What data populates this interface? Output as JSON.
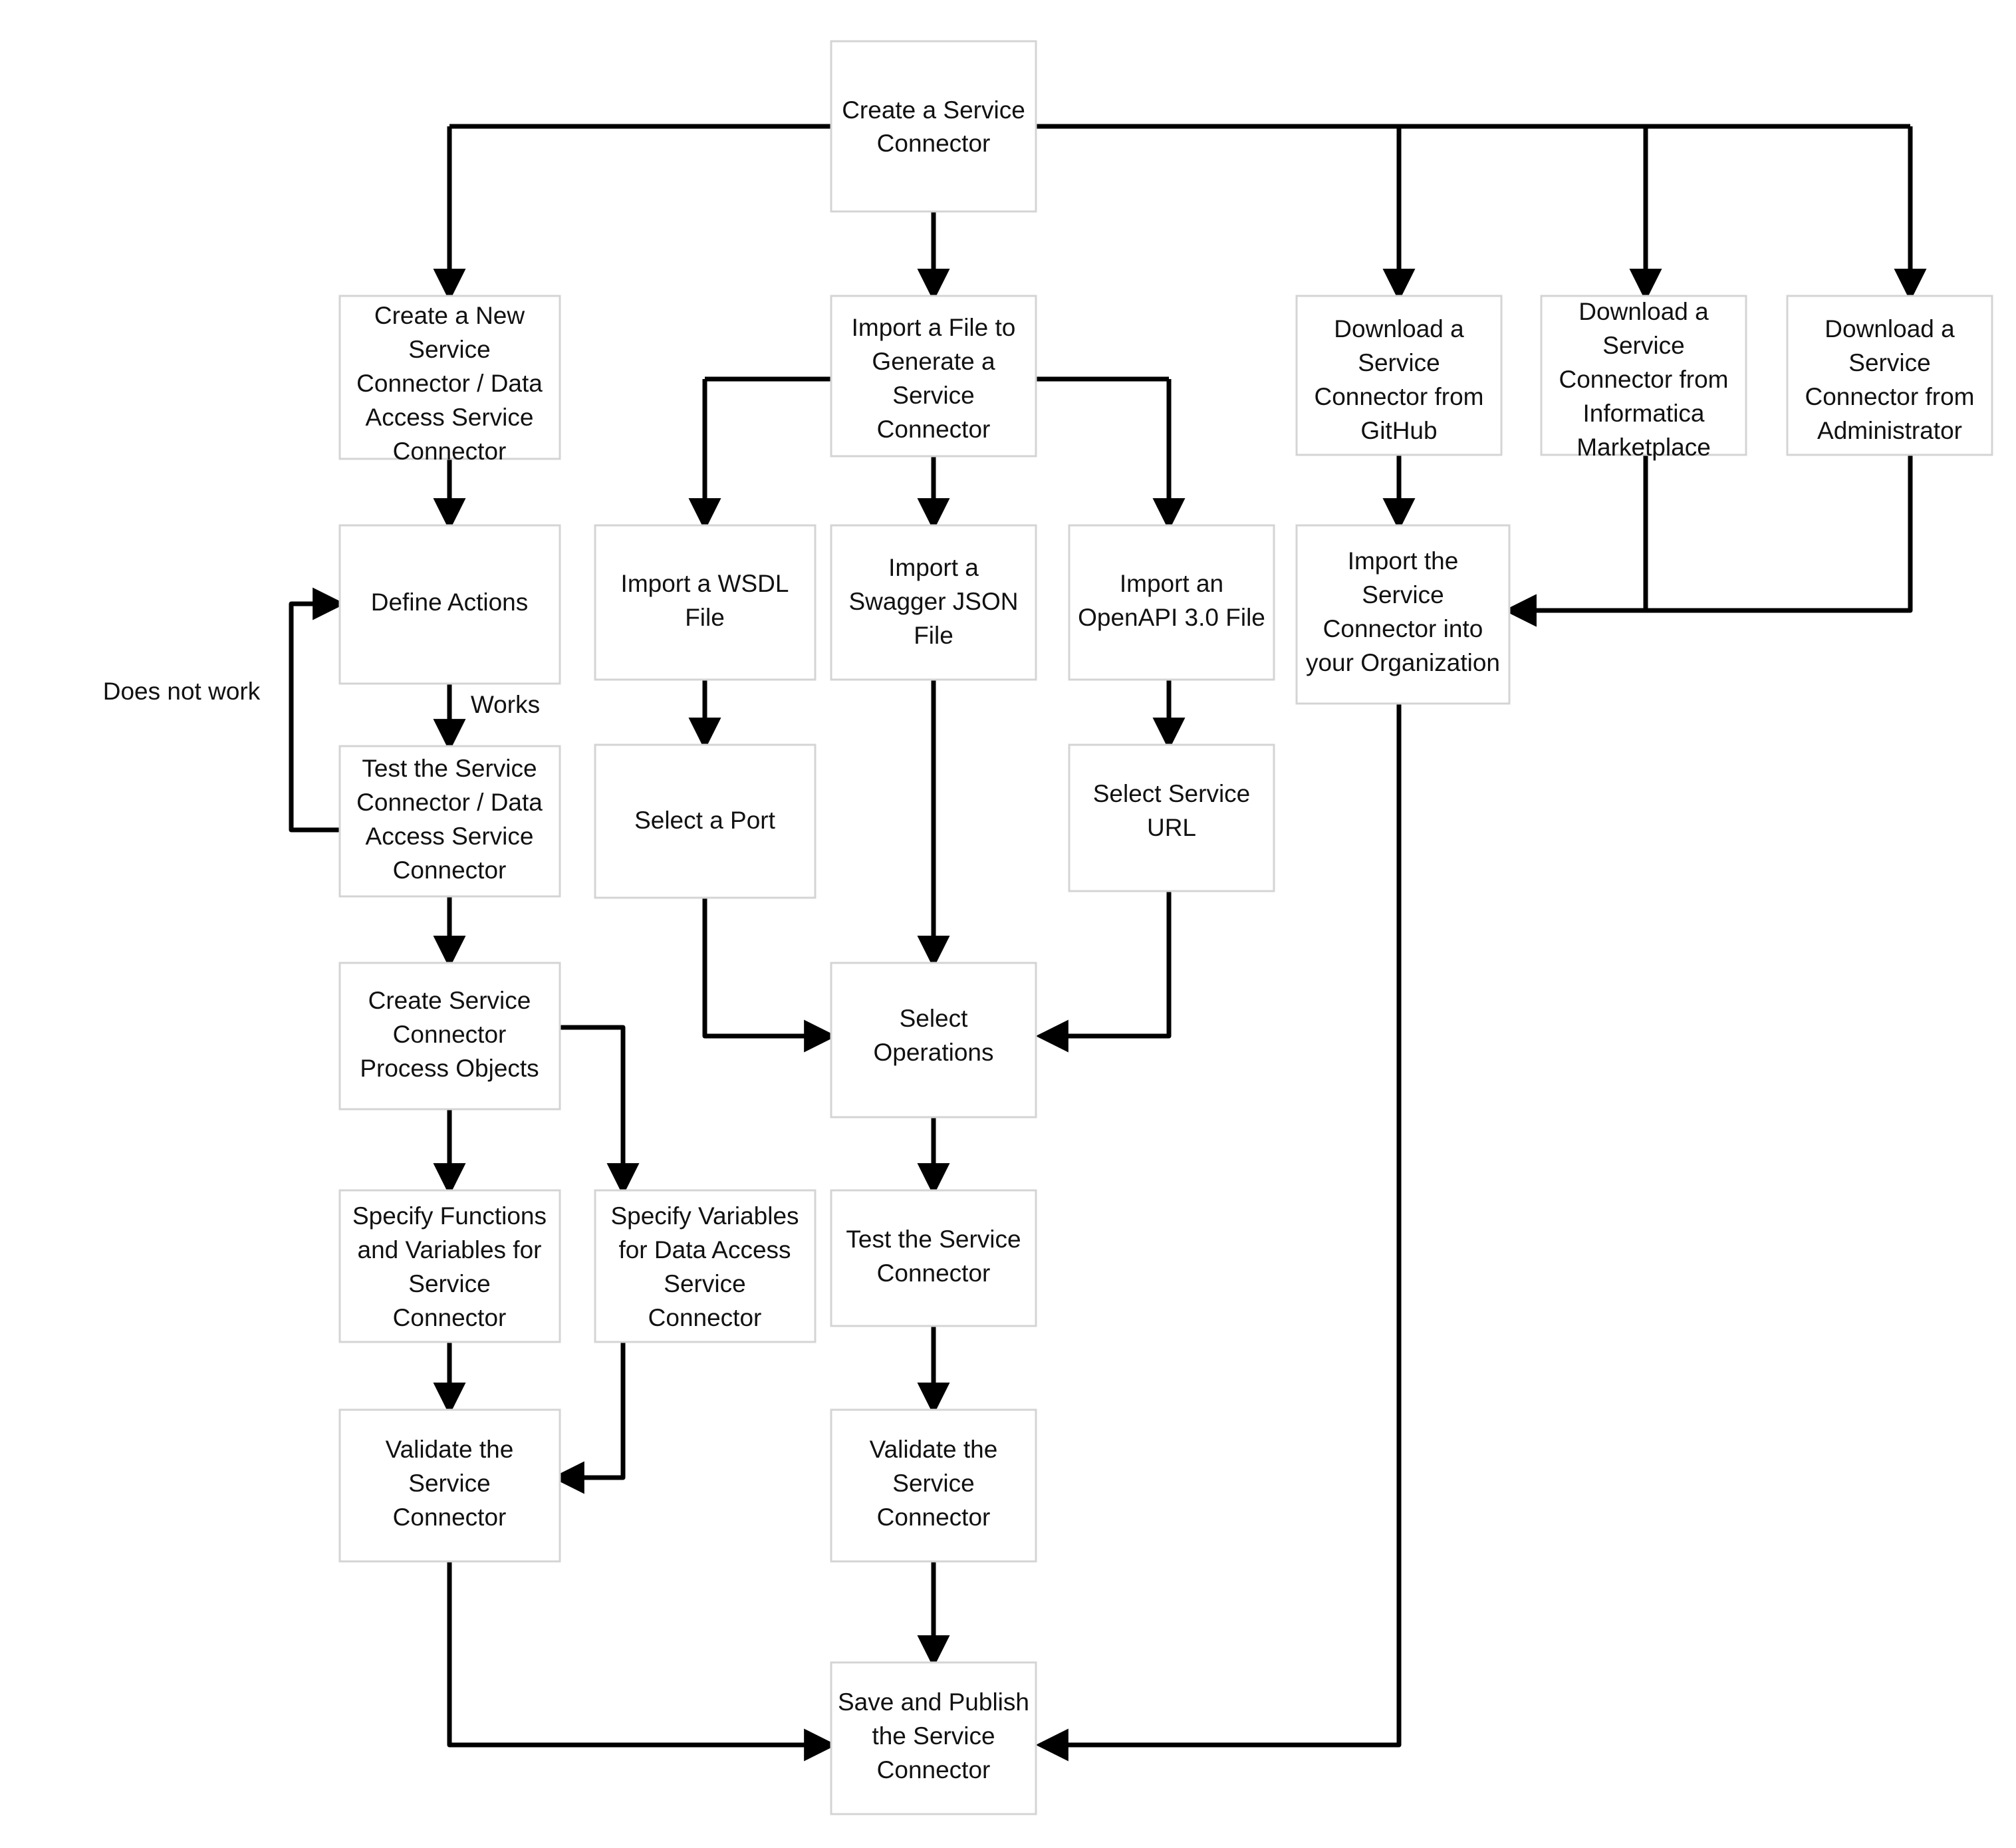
{
  "diagram": {
    "type": "flowchart",
    "title": "Create a Service Connector",
    "background_color": "#ffffff",
    "box_fill_color": "#ffffff",
    "box_border_color": "#d4d4d4",
    "edge_color": "#000000",
    "text_color": "#111111",
    "nodes": [
      {
        "id": "create_service_connector",
        "label": "Create a Service\nConnector",
        "lines": [
          "Create a Service",
          "Connector"
        ]
      },
      {
        "id": "create_new_sc",
        "label": "Create a New Service Connector / Data Access Service Connector",
        "lines": [
          "Create a New",
          "Service",
          "Connector / Data",
          "Access Service",
          "Connector"
        ]
      },
      {
        "id": "import_file_generate",
        "label": "Import a File to Generate a Service Connector",
        "lines": [
          "Import a File to",
          "Generate a",
          "Service",
          "Connector"
        ]
      },
      {
        "id": "download_github",
        "label": "Download a Service Connector from GitHub",
        "lines": [
          "Download a",
          "Service",
          "Connector from",
          "GitHub"
        ]
      },
      {
        "id": "download_marketplace",
        "label": "Download a Service Connector from Informatica Marketplace",
        "lines": [
          "Download a",
          "Service",
          "Connector from",
          "Informatica",
          "Marketplace"
        ]
      },
      {
        "id": "download_administrator",
        "label": "Download a Service Connector from Administrator",
        "lines": [
          "Download a",
          "Service",
          "Connector from",
          "Administrator"
        ]
      },
      {
        "id": "define_actions",
        "label": "Define Actions",
        "lines": [
          "Define Actions"
        ]
      },
      {
        "id": "import_wsdl",
        "label": "Import a WSDL File",
        "lines": [
          "Import a WSDL",
          "File"
        ]
      },
      {
        "id": "import_swagger",
        "label": "Import a Swagger JSON File",
        "lines": [
          "Import a",
          "Swagger JSON",
          "File"
        ]
      },
      {
        "id": "import_openapi",
        "label": "Import an OpenAPI 3.0 File",
        "lines": [
          "Import an",
          "OpenAPI 3.0 File"
        ]
      },
      {
        "id": "import_into_org",
        "label": "Import the Service Connector into your Organization",
        "lines": [
          "Import the",
          "Service",
          "Connector into",
          "your Organization"
        ]
      },
      {
        "id": "test_sc_das",
        "label": "Test the Service Connector / Data Access Service Connector",
        "lines": [
          "Test the Service",
          "Connector / Data",
          "Access Service",
          "Connector"
        ]
      },
      {
        "id": "select_port",
        "label": "Select a Port",
        "lines": [
          "Select a Port"
        ]
      },
      {
        "id": "select_service_url",
        "label": "Select Service URL",
        "lines": [
          "Select Service",
          "URL"
        ]
      },
      {
        "id": "create_process_objects",
        "label": "Create Service Connector Process Objects",
        "lines": [
          "Create Service",
          "Connector",
          "Process Objects"
        ]
      },
      {
        "id": "select_operations",
        "label": "Select Operations",
        "lines": [
          "Select",
          "Operations"
        ]
      },
      {
        "id": "specify_functions",
        "label": "Specify Functions and Variables for Service Connector",
        "lines": [
          "Specify Functions",
          "and Variables for",
          "Service",
          "Connector"
        ]
      },
      {
        "id": "specify_variables_das",
        "label": "Specify Variables for Data Access Service Connector",
        "lines": [
          "Specify Variables",
          "for Data Access",
          "Service",
          "Connector"
        ]
      },
      {
        "id": "test_service_connector",
        "label": "Test the Service Connector",
        "lines": [
          "Test the Service",
          "Connector"
        ]
      },
      {
        "id": "validate_left",
        "label": "Validate the Service Connector",
        "lines": [
          "Validate the",
          "Service",
          "Connector"
        ]
      },
      {
        "id": "validate_mid",
        "label": "Validate the Service Connector",
        "lines": [
          "Validate the",
          "Service",
          "Connector"
        ]
      },
      {
        "id": "save_publish",
        "label": "Save and Publish the Service Connector",
        "lines": [
          "Save and Publish",
          "the Service",
          "Connector"
        ]
      }
    ],
    "edge_labels": [
      {
        "id": "does_not_work",
        "text": "Does not work"
      },
      {
        "id": "works",
        "text": "Works"
      }
    ],
    "edges": [
      {
        "from": "create_service_connector",
        "to": "create_new_sc"
      },
      {
        "from": "create_service_connector",
        "to": "import_file_generate"
      },
      {
        "from": "create_service_connector",
        "to": "download_github"
      },
      {
        "from": "create_service_connector",
        "to": "download_marketplace"
      },
      {
        "from": "create_service_connector",
        "to": "download_administrator"
      },
      {
        "from": "create_new_sc",
        "to": "define_actions"
      },
      {
        "from": "import_file_generate",
        "to": "import_wsdl"
      },
      {
        "from": "import_file_generate",
        "to": "import_swagger"
      },
      {
        "from": "import_file_generate",
        "to": "import_openapi"
      },
      {
        "from": "download_github",
        "to": "import_into_org"
      },
      {
        "from": "download_marketplace",
        "to": "import_into_org"
      },
      {
        "from": "download_administrator",
        "to": "import_into_org"
      },
      {
        "from": "define_actions",
        "to": "test_sc_das",
        "label": "Works"
      },
      {
        "from": "test_sc_das",
        "to": "define_actions",
        "label": "Does not work"
      },
      {
        "from": "import_wsdl",
        "to": "select_port"
      },
      {
        "from": "import_openapi",
        "to": "select_service_url"
      },
      {
        "from": "test_sc_das",
        "to": "create_process_objects"
      },
      {
        "from": "select_port",
        "to": "select_operations"
      },
      {
        "from": "import_swagger",
        "to": "select_operations"
      },
      {
        "from": "select_service_url",
        "to": "select_operations"
      },
      {
        "from": "create_process_objects",
        "to": "specify_functions"
      },
      {
        "from": "create_process_objects",
        "to": "specify_variables_das"
      },
      {
        "from": "select_operations",
        "to": "test_service_connector"
      },
      {
        "from": "specify_functions",
        "to": "validate_left"
      },
      {
        "from": "specify_variables_das",
        "to": "validate_left"
      },
      {
        "from": "test_service_connector",
        "to": "validate_mid"
      },
      {
        "from": "validate_left",
        "to": "save_publish"
      },
      {
        "from": "validate_mid",
        "to": "save_publish"
      },
      {
        "from": "import_into_org",
        "to": "save_publish"
      }
    ]
  }
}
